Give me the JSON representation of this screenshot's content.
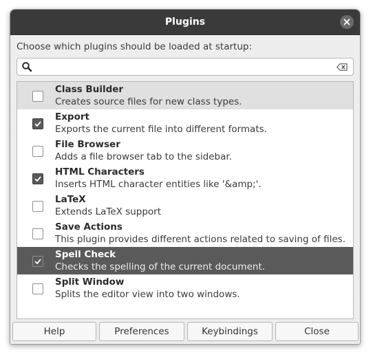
{
  "dialog": {
    "title": "Plugins",
    "prompt": "Choose which plugins should be loaded at startup:"
  },
  "search": {
    "value": "",
    "placeholder": ""
  },
  "plugins": [
    {
      "name": "Class Builder",
      "description": "Creates source files for new class types.",
      "enabled": false,
      "state": "hover"
    },
    {
      "name": "Export",
      "description": "Exports the current file into different formats.",
      "enabled": true,
      "state": "normal"
    },
    {
      "name": "File Browser",
      "description": "Adds a file browser tab to the sidebar.",
      "enabled": false,
      "state": "normal"
    },
    {
      "name": "HTML Characters",
      "description": "Inserts HTML character entities like '&amp;'.",
      "enabled": true,
      "state": "normal"
    },
    {
      "name": "LaTeX",
      "description": "Extends LaTeX support",
      "enabled": false,
      "state": "normal"
    },
    {
      "name": "Save Actions",
      "description": "This plugin provides different actions related to saving of files.",
      "enabled": false,
      "state": "normal"
    },
    {
      "name": "Spell Check",
      "description": "Checks the spelling of the current document.",
      "enabled": true,
      "state": "selected"
    },
    {
      "name": "Split Window",
      "description": "Splits the editor view into two windows.",
      "enabled": false,
      "state": "normal"
    }
  ],
  "buttons": {
    "help": "Help",
    "preferences": "Preferences",
    "keybindings": "Keybindings",
    "close": "Close"
  },
  "icons": {
    "window_close": "close-icon",
    "search": "search-icon",
    "clear": "clear-icon",
    "check": "checkmark-icon"
  },
  "colors": {
    "titlebar": "#3a3a3a",
    "selected_row": "#5a5a5a",
    "hover_row": "#e0e0e0"
  }
}
